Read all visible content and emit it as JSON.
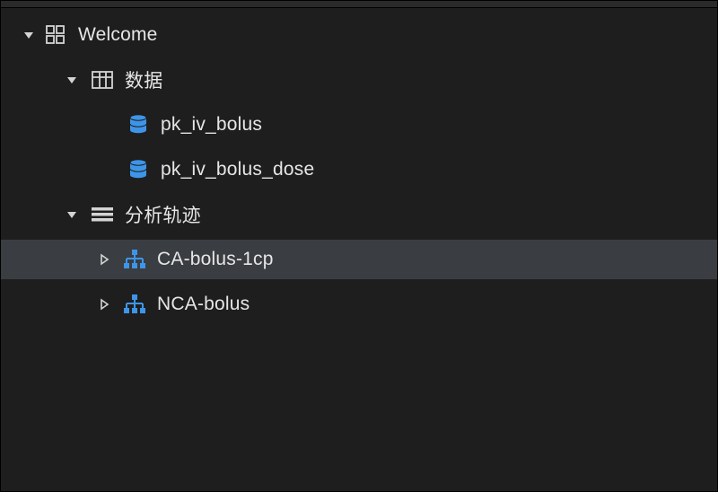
{
  "tree": {
    "welcome_label": "Welcome",
    "data_group_label": "数据",
    "data_items": [
      {
        "label": "pk_iv_bolus"
      },
      {
        "label": "pk_iv_bolus_dose"
      }
    ],
    "analysis_group_label": "分析轨迹",
    "analysis_items": [
      {
        "label": "CA-bolus-1cp",
        "selected": true
      },
      {
        "label": "NCA-bolus",
        "selected": false
      }
    ]
  },
  "colors": {
    "background": "#1e1e1e",
    "selected_row": "#3a3d41",
    "text": "#e6e6e6",
    "accent_blue": "#3e95e8",
    "icon_neutral": "#d4d4d4"
  }
}
